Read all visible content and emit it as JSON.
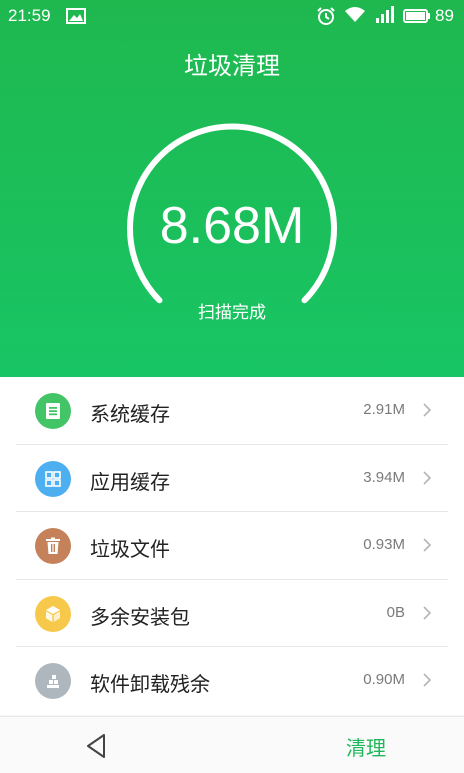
{
  "status_bar": {
    "time": "21:59",
    "battery_level": "89",
    "icons": [
      "image-icon",
      "alarm-icon",
      "wifi-icon",
      "signal-icon",
      "battery-icon"
    ]
  },
  "header": {
    "title": "垃圾清理"
  },
  "scan": {
    "size": "8.68M",
    "status": "扫描完成"
  },
  "items": [
    {
      "label": "系统缓存",
      "value": "2.91M",
      "icon": "document-icon",
      "color": "#43c467"
    },
    {
      "label": "应用缓存",
      "value": "3.94M",
      "icon": "grid-icon",
      "color": "#4daef0"
    },
    {
      "label": "垃圾文件",
      "value": "0.93M",
      "icon": "trash-icon",
      "color": "#c58159"
    },
    {
      "label": "多余安装包",
      "value": "0B",
      "icon": "package-icon",
      "color": "#f7c94a"
    },
    {
      "label": "软件卸载残余",
      "value": "0.90M",
      "icon": "residue-icon",
      "color": "#aeb7be"
    }
  ],
  "bottom_bar": {
    "clean_label": "清理"
  },
  "colors": {
    "accent": "#20b85a",
    "header_green": "#1fb84f"
  }
}
